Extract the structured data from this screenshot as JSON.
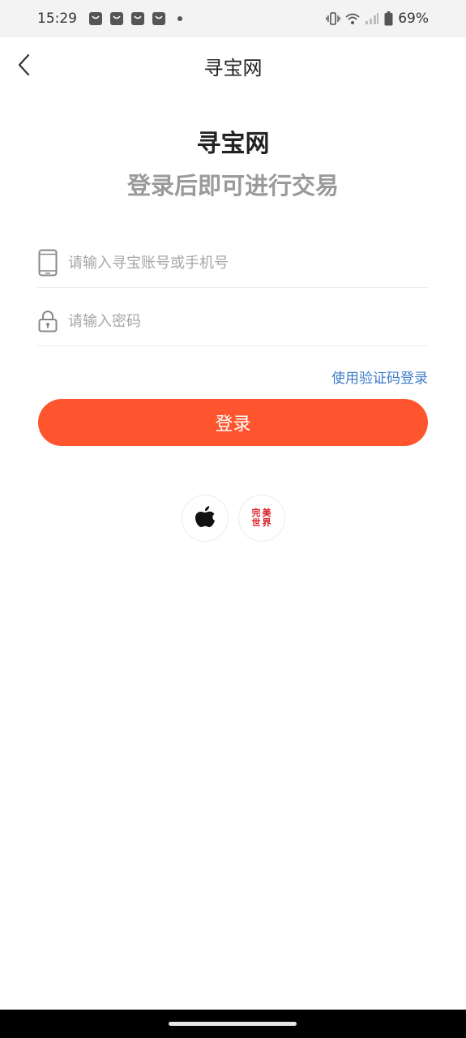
{
  "status_bar": {
    "time": "15:29",
    "battery_percent": "69%",
    "notification_icons": [
      "shopping-bag-icon",
      "shopping-bag-icon",
      "shopping-bag-icon",
      "shopping-bag-icon"
    ],
    "system_icons": [
      "vibrate-icon",
      "wifi-icon",
      "signal-icon",
      "battery-icon"
    ]
  },
  "nav": {
    "back_icon": "chevron-left-icon",
    "title": "寻宝网"
  },
  "header": {
    "brand": "寻宝网",
    "subtitle": "登录后即可进行交易"
  },
  "form": {
    "account": {
      "icon": "phone-icon",
      "placeholder": "请输入寻宝账号或手机号",
      "value": ""
    },
    "password": {
      "icon": "lock-icon",
      "placeholder": "请输入密码",
      "value": ""
    },
    "code_login_link": "使用验证码登录",
    "login_button": "登录"
  },
  "third_party": [
    {
      "name": "apple",
      "icon": "apple-icon"
    },
    {
      "name": "wanmei",
      "icon": "wanmei-logo-icon",
      "logo_chars": [
        "完",
        "美",
        "世",
        "界"
      ]
    }
  ],
  "colors": {
    "accent": "#ff552e",
    "link": "#3d7cc9",
    "subtitle": "#9a9a9a",
    "brand_logo": "#d71920"
  }
}
